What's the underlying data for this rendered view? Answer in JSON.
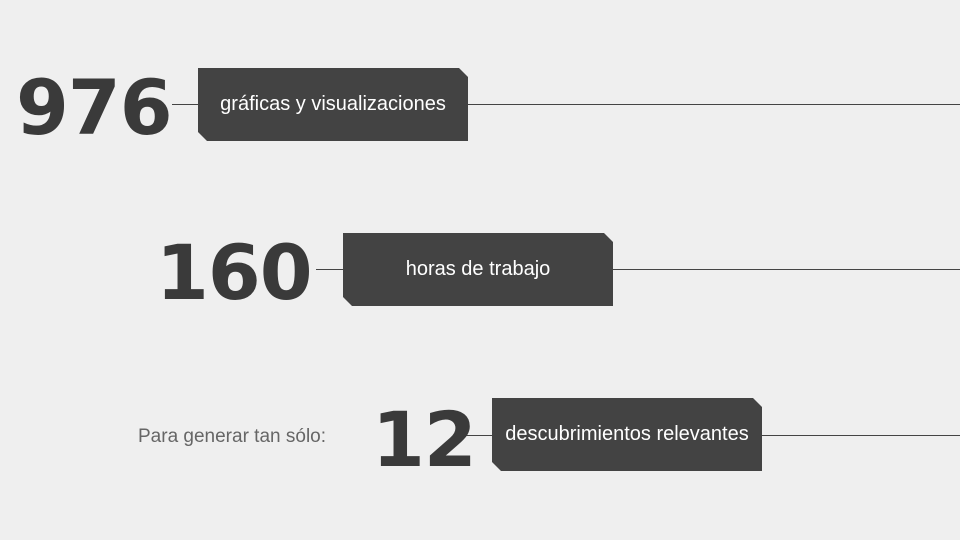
{
  "stats": [
    {
      "number": "976",
      "label": "gráficas y visualizaciones"
    },
    {
      "number": "160",
      "label": "horas de trabajo"
    },
    {
      "number": "12",
      "label": "descubrimientos relevantes"
    }
  ],
  "prefix_text": "Para generar tan sólo:",
  "colors": {
    "background": "#efefef",
    "number": "#3a3a3a",
    "box": "#434343",
    "box_text": "#ffffff",
    "line": "#444444",
    "prefix": "#666666"
  }
}
